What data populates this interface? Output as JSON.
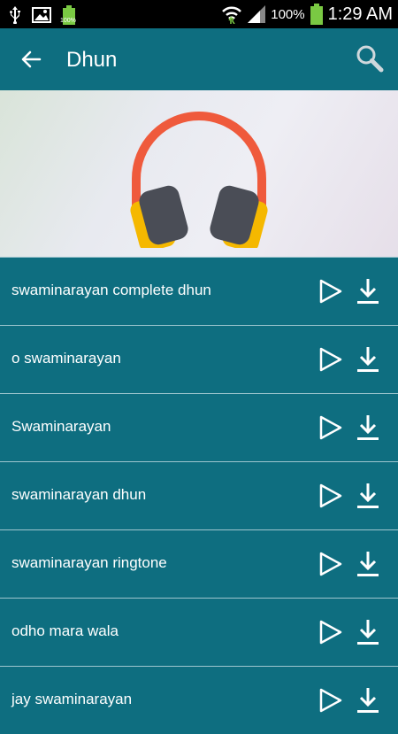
{
  "status": {
    "battery_mini": "100%",
    "battery_percent": "100%",
    "time": "1:29 AM"
  },
  "appbar": {
    "title": "Dhun"
  },
  "tracks": [
    "swaminarayan complete dhun",
    "o swaminarayan",
    "Swaminarayan",
    "swaminarayan dhun",
    "swaminarayan ringtone",
    "odho mara wala",
    "jay swaminarayan"
  ],
  "colors": {
    "primary": "#0e6e80",
    "headband": "#ef5a3c",
    "ear_cup": "#4a4d56",
    "ear_rim": "#f5b800"
  }
}
